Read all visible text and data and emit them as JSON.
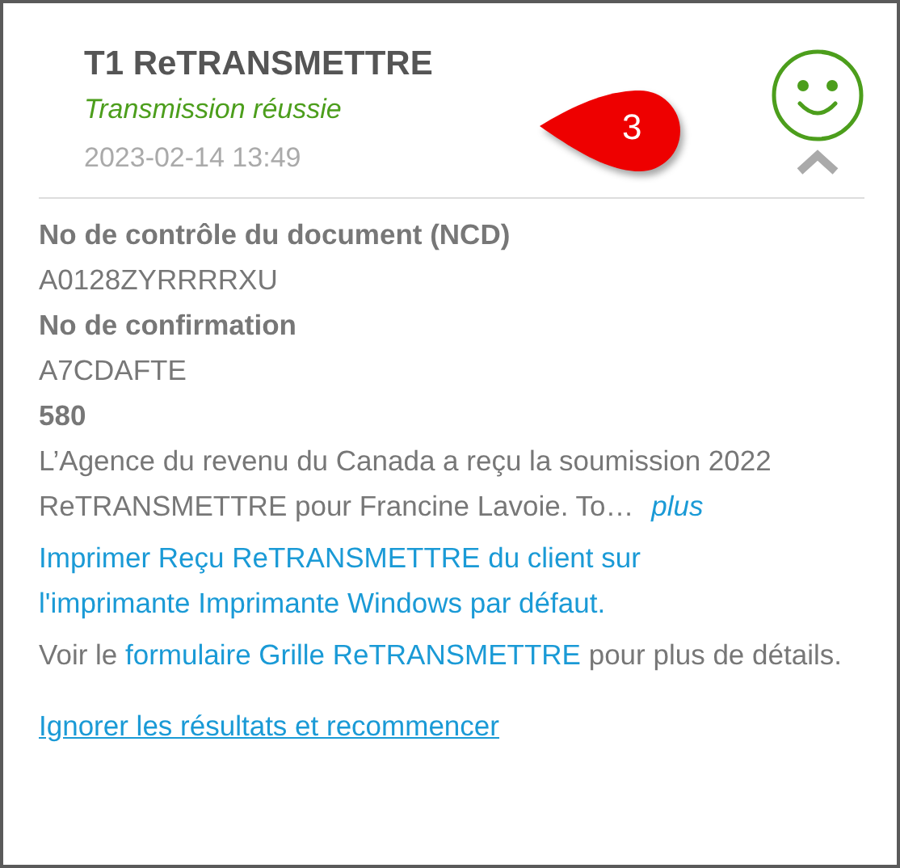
{
  "header": {
    "title": "T1 ReTRANSMETTRE",
    "status": "Transmission réussie",
    "timestamp": "2023-02-14 13:49",
    "expanded": true,
    "callout": "3"
  },
  "details": [
    {
      "kind": "label",
      "text": "No de contrôle du document (NCD)"
    },
    {
      "kind": "value",
      "text": "A0128ZYRRRRXU"
    },
    {
      "kind": "label",
      "text": "No de confirmation"
    },
    {
      "kind": "value",
      "text": "A7CDAFTE"
    },
    {
      "kind": "label",
      "text": "580"
    }
  ],
  "message": {
    "text": "L’Agence du revenu du Canada a reçu la soumission 2022 ReTRANSMETTRE pour Francine Lavoie. To…",
    "more_link": "plus"
  },
  "print_link": "Imprimer Reçu ReTRANSMETTRE du client sur l'imprimante Imprimante Windows par défaut.",
  "form_note": {
    "before": "Voir le",
    "link": "formulaire Grille ReTRANSMETTRE",
    "after": "pour plus de détails."
  },
  "reset_link": "Ignorer les résultats et recommencer"
}
